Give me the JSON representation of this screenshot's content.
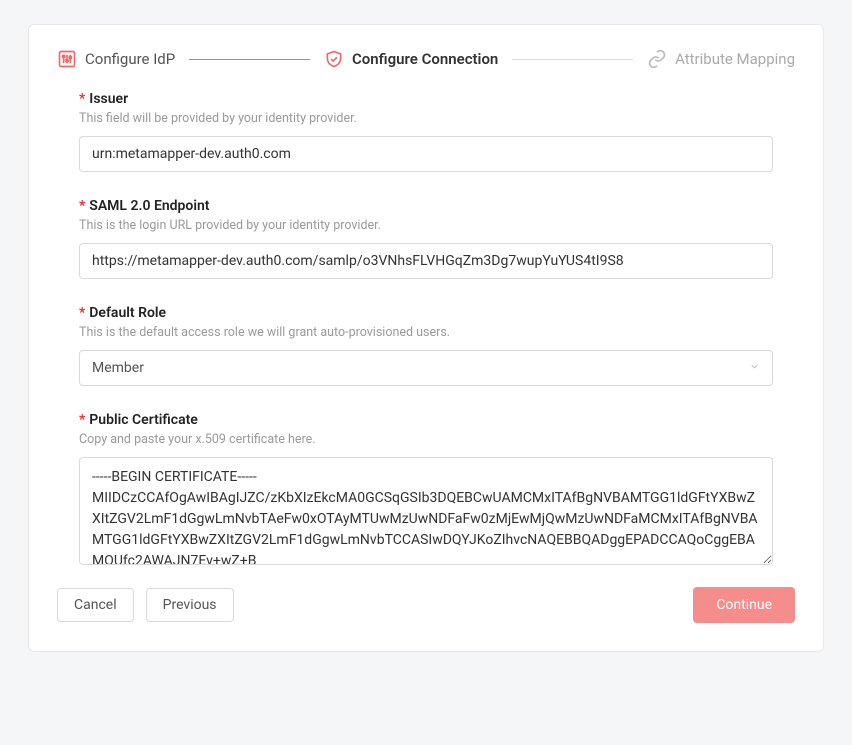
{
  "stepper": {
    "step1": "Configure IdP",
    "step2": "Configure Connection",
    "step3": "Attribute Mapping"
  },
  "fields": {
    "issuer": {
      "label": "Issuer",
      "help": "This field will be provided by your identity provider.",
      "value": "urn:metamapper-dev.auth0.com"
    },
    "endpoint": {
      "label": "SAML 2.0 Endpoint",
      "help": "This is the login URL provided by your identity provider.",
      "value": "https://metamapper-dev.auth0.com/samlp/o3VNhsFLVHGqZm3Dg7wupYuYUS4tI9S8"
    },
    "role": {
      "label": "Default Role",
      "help": "This is the default access role we will grant auto-provisioned users.",
      "value": "Member"
    },
    "cert": {
      "label": "Public Certificate",
      "help": "Copy and paste your x.509 certificate here.",
      "value": "-----BEGIN CERTIFICATE-----\nMIIDCzCCAfOgAwIBAgIJZC/zKbXIzEkcMA0GCSqGSIb3DQEBCwUAMCMxITAfBgNVBAMTGG1ldGFtYXBwZXItZGV2LmF1dGgwLmNvbTAeFw0xOTAyMTUwMzUwNDFaFw0zMjEwMjQwMzUwNDFaMCMxITAfBgNVBAMTGG1ldGFtYXBwZXItZGV2LmF1dGgwLmNvbTCCASIwDQYJKoZIhvcNAQEBBQADggEPADCCAQoCggEBAMQUfc2AWAJN7Ev+wZ+B"
    }
  },
  "buttons": {
    "cancel": "Cancel",
    "previous": "Previous",
    "continue": "Continue"
  }
}
